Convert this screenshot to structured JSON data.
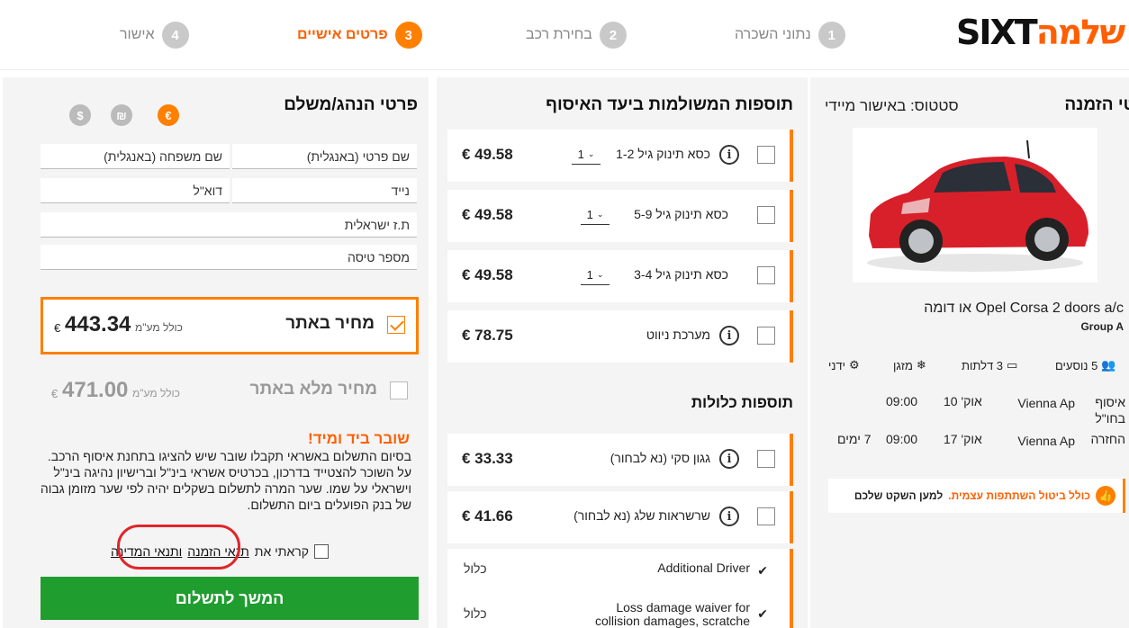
{
  "logo": {
    "heb": "שלמה",
    "latin": "SIXT"
  },
  "steps": [
    {
      "num": "1",
      "label": "נתוני השכרה"
    },
    {
      "num": "2",
      "label": "בחירת רכב"
    },
    {
      "num": "3",
      "label": "פרטים אישיים"
    },
    {
      "num": "4",
      "label": "אישור"
    }
  ],
  "driver": {
    "title": "פרטי הנהג/משלם",
    "currencies": [
      "€",
      "₪",
      "$"
    ],
    "fields": {
      "first_name": "שם פרטי (באנגלית)",
      "last_name": "שם משפחה (באנגלית)",
      "mobile": "נייד",
      "email": "דוא\"ל",
      "id": "ת.ז ישראלית",
      "flight": "מספר טיסה"
    },
    "price_site": {
      "label": "מחיר באתר",
      "sub": "כולל מע\"מ",
      "value": "443.34",
      "cur": "€"
    },
    "price_full": {
      "label": "מחיר מלא באתר",
      "sub": "כולל מע\"מ",
      "value": "471.00",
      "cur": "€"
    },
    "voucher_title": "שובר ביד ומיד!",
    "voucher_text": "בסיום התשלום באשראי תקבלו שובר שיש להציגו בתחנת איסוף הרכב. על השוכר להצטייד בדרכון, בכרטיס אשראי בינ\"ל וברישיון נהיגה בינ\"ל וישראלי על שמו. שער המרה לתשלום בשקלים יהיה לפי שער מזומן גבוה של בנק הפועלים ביום התשלום.",
    "terms_prefix": "קראתי את",
    "terms_link1": "תנאי הזמנה",
    "terms_link2": "ותנאי המדינה",
    "cta": "המשך לתשלום"
  },
  "addons": {
    "title": "תוספות המשולמות ביעד האיסוף",
    "items": [
      {
        "label": "כסא תינוק גיל 1-2",
        "qty": "1",
        "price": "€ 49.58"
      },
      {
        "label": "כסא תינוק גיל 5-9",
        "qty": "1",
        "price": "€ 49.58"
      },
      {
        "label": "כסא תינוק גיל 3-4",
        "qty": "1",
        "price": "€ 49.58"
      },
      {
        "label": "מערכת ניווט",
        "price": "€ 78.75"
      }
    ],
    "included_title": "תוספות כלולות",
    "included_paid": [
      {
        "label": "גגון סקי (נא לבחור)",
        "price": "€ 33.33"
      },
      {
        "label": "שרשראות שלג (נא לבחור)",
        "price": "€ 41.66"
      }
    ],
    "included": [
      {
        "name": "Additional Driver",
        "value": "כלול"
      },
      {
        "name": "Loss damage waiver for collision damages, scratche",
        "value": "כלול"
      }
    ]
  },
  "order": {
    "title": "פרטי הזמנה",
    "status": "סטטוס: באישור מיידי",
    "car_name": "Opel Corsa 2 doors a/c או דומה",
    "car_group": "Group A",
    "features": {
      "seats": "5 נוסעים",
      "doors": "3 דלתות",
      "ac": "מזגן",
      "gear": "ידני"
    },
    "pickup": {
      "label": "איסוף בחו\"ל",
      "place": "Vienna Ap",
      "date": "אוק' 10",
      "time": "09:00"
    },
    "return": {
      "label": "החזרה",
      "place": "Vienna Ap",
      "date": "אוק' 17",
      "time": "09:00",
      "days": "7 ימים"
    },
    "note_orange": "כולל ביטול השתתפות עצמית.",
    "note_black": "למען השקט שלכם"
  },
  "colors": {
    "accent": "#ff7f00",
    "cta": "#1f9d2f",
    "highlight": "#e0262a"
  }
}
